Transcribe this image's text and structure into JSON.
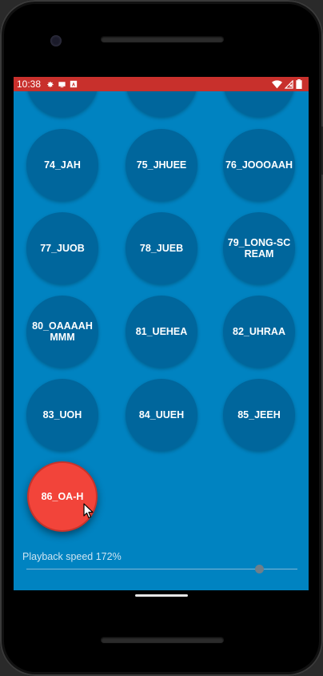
{
  "status": {
    "time": "10:38",
    "icons_left": [
      "settings-icon",
      "display-icon",
      "font-icon"
    ],
    "icons_right": [
      "wifi-icon",
      "no-signal-icon",
      "battery-icon"
    ]
  },
  "buttons": [
    {
      "label": "",
      "partial": true
    },
    {
      "label": "",
      "partial": true
    },
    {
      "label": "",
      "partial": true
    },
    {
      "label": "74_JAH"
    },
    {
      "label": "75_JHUEE"
    },
    {
      "label": "76_JOOOAAH"
    },
    {
      "label": "77_JUOB"
    },
    {
      "label": "78_JUEB"
    },
    {
      "label": "79_LONG-SCREAM"
    },
    {
      "label": "80_OAAAAHMMM"
    },
    {
      "label": "81_UEHEA"
    },
    {
      "label": "82_UHRAA"
    },
    {
      "label": "83_UOH"
    },
    {
      "label": "84_UUEH"
    },
    {
      "label": "85_JEEH"
    },
    {
      "label": "86_OA-H",
      "active": true
    }
  ],
  "playback": {
    "label": "Playback speed 172%",
    "value_percent": 172
  },
  "colors": {
    "statusbar": "#c8302c",
    "background": "#0083c1",
    "button": "#00669c",
    "active_button": "#f2443a"
  }
}
